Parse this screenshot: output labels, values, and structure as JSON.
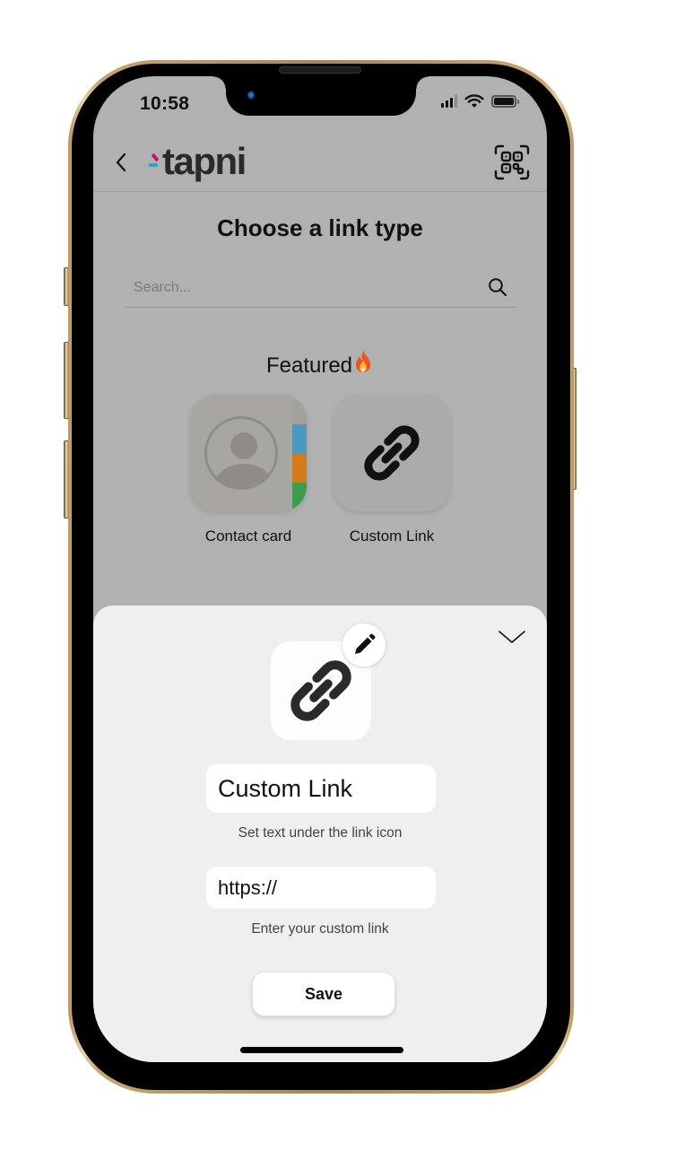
{
  "status_bar": {
    "time": "10:58",
    "icons": [
      "cellular-signal-icon",
      "wifi-icon",
      "battery-icon"
    ]
  },
  "header": {
    "back_icon": "chevron-left-icon",
    "logo_text": "tapni",
    "qr_icon": "qr-code-scan-icon",
    "brand_colors": {
      "pink": "#c2185b",
      "cyan": "#26a9c6",
      "text": "#2a2a2a"
    }
  },
  "page": {
    "title": "Choose a link type",
    "search": {
      "placeholder": "Search...",
      "value": "",
      "icon": "search-icon"
    },
    "featured": {
      "title": "Featured",
      "emoji": "🔥",
      "items": [
        {
          "label": "Contact card",
          "icon": "contact-card-icon"
        },
        {
          "label": "Custom Link",
          "icon": "link-icon"
        }
      ]
    }
  },
  "sheet": {
    "collapse_icon": "chevron-down-icon",
    "link_icon": "link-icon",
    "edit_icon": "pencil-icon",
    "title_field": {
      "value": "Custom Link",
      "helper": "Set text under the link icon"
    },
    "url_field": {
      "value": "https://",
      "helper": "Enter your custom link"
    },
    "save_label": "Save"
  },
  "colors": {
    "overlay_background": "#b1b1b1",
    "sheet_background": "#efefef",
    "contact_tabs": [
      "#a3a19c",
      "#4a9ac0",
      "#d07c1a",
      "#3d9d4c"
    ]
  }
}
